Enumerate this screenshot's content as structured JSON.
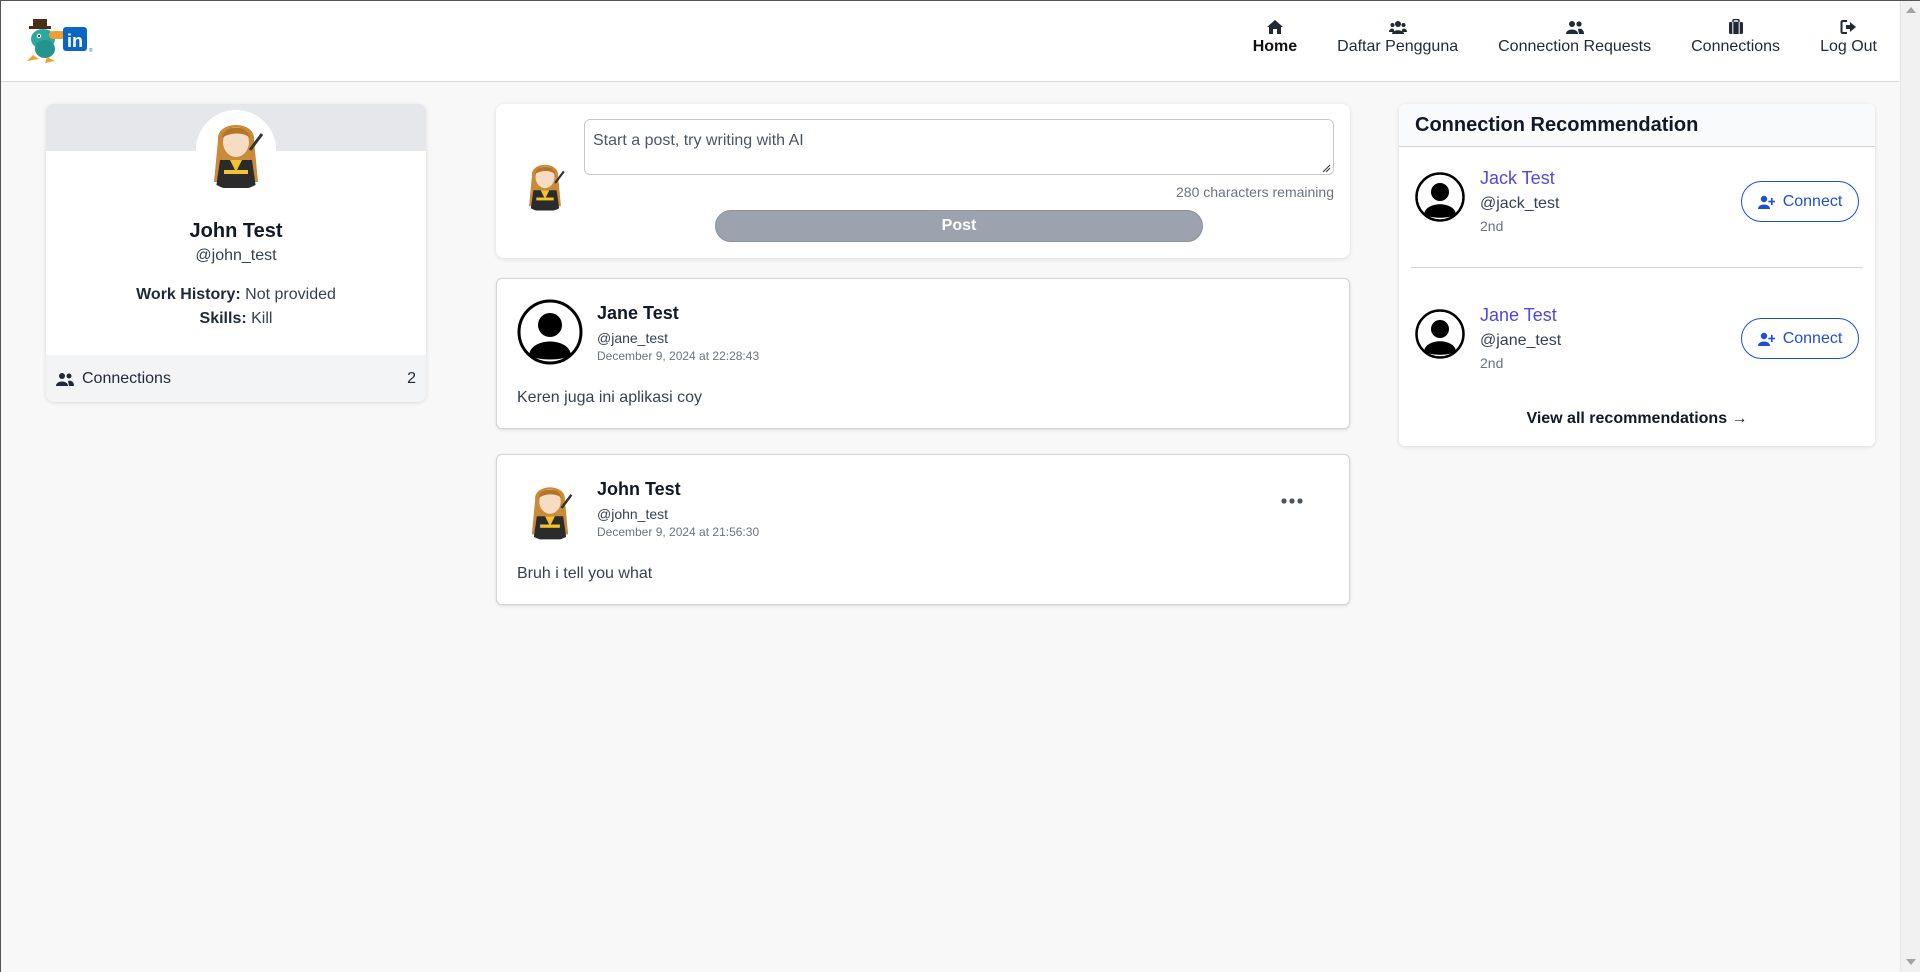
{
  "nav": {
    "items": [
      {
        "label": "Home",
        "icon": "home-icon",
        "active": true
      },
      {
        "label": "Daftar Pengguna",
        "icon": "users-icon",
        "active": false
      },
      {
        "label": "Connection Requests",
        "icon": "user-group-icon",
        "active": false
      },
      {
        "label": "Connections",
        "icon": "briefcase-icon",
        "active": false
      },
      {
        "label": "Log Out",
        "icon": "sign-out-icon",
        "active": false
      }
    ]
  },
  "profile": {
    "name": "John Test",
    "handle": "@john_test",
    "work_label": "Work History:",
    "work_value": "Not provided",
    "skills_label": "Skills:",
    "skills_value": "Kill",
    "connections_label": "Connections",
    "connections_count": "2"
  },
  "composer": {
    "placeholder": "Start a post, try writing with AI",
    "remaining": "280 characters remaining",
    "post_label": "Post"
  },
  "posts": [
    {
      "name": "Jane Test",
      "handle": "@jane_test",
      "time": "December 9, 2024 at 22:28:43",
      "body": "Keren juga ini aplikasi coy",
      "owned": false
    },
    {
      "name": "John Test",
      "handle": "@john_test",
      "time": "December 9, 2024 at 21:56:30",
      "body": "Bruh i tell you what",
      "owned": true
    }
  ],
  "recommendations": {
    "title": "Connection Recommendation",
    "items": [
      {
        "name": "Jack Test",
        "handle": "@jack_test",
        "degree": "2nd",
        "button": "Connect"
      },
      {
        "name": "Jane Test",
        "handle": "@jane_test",
        "degree": "2nd",
        "button": "Connect"
      }
    ],
    "view_all": "View all recommendations →"
  },
  "colors": {
    "accent_link": "#4f46e5",
    "connect_blue": "#1d4ed8",
    "post_button_disabled": "#9ca3af",
    "linkedin_blue": "#0a66c2"
  }
}
